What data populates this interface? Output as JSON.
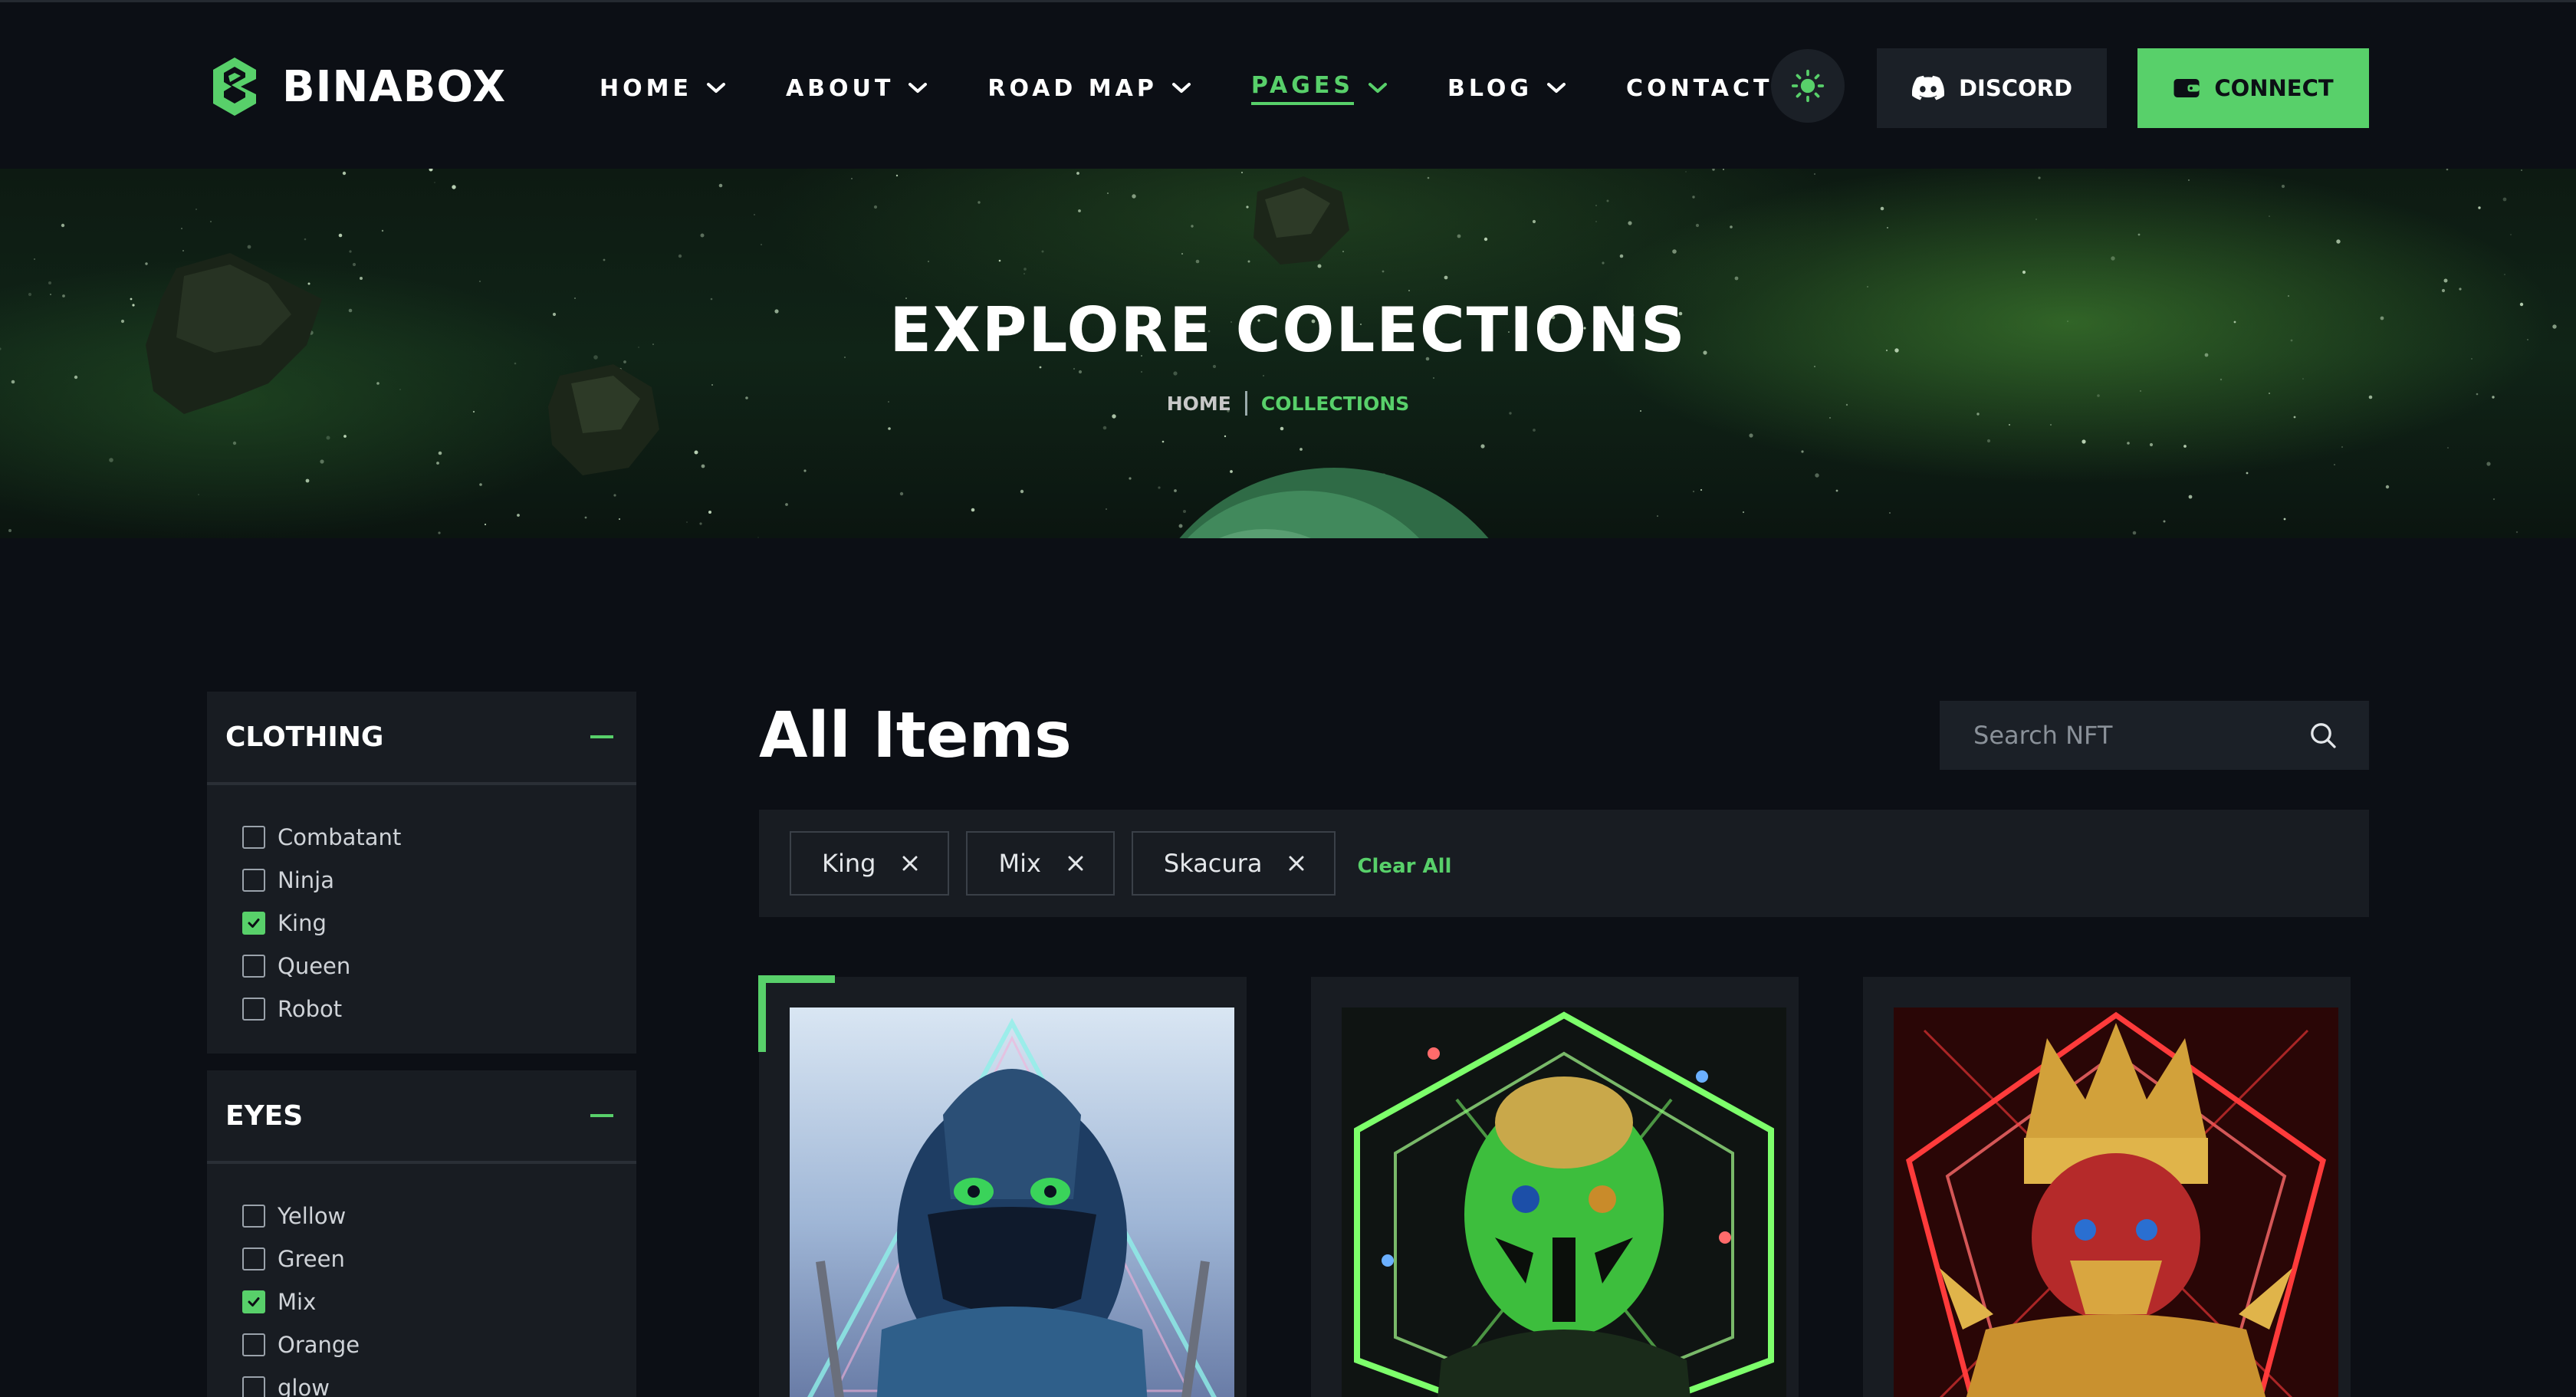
{
  "brand": {
    "name": "BINABOX",
    "accent": "#58d06a",
    "background": "#0c0f15",
    "panel": "#181c22"
  },
  "nav": {
    "items": [
      {
        "label": "HOME",
        "dropdown": true,
        "active": false
      },
      {
        "label": "ABOUT",
        "dropdown": true,
        "active": false
      },
      {
        "label": "ROAD MAP",
        "dropdown": true,
        "active": false
      },
      {
        "label": "PAGES",
        "dropdown": true,
        "active": true
      },
      {
        "label": "BLOG",
        "dropdown": true,
        "active": false
      },
      {
        "label": "CONTACT",
        "dropdown": false,
        "active": false
      }
    ],
    "theme_icon": "sun-icon",
    "discord_label": "DISCORD",
    "connect_label": "CONNECT"
  },
  "hero": {
    "title": "EXPLORE COLECTIONS",
    "breadcrumb_home": "HOME",
    "breadcrumb_current": "COLLECTIONS"
  },
  "filters": [
    {
      "title": "CLOTHING",
      "options": [
        {
          "label": "Combatant",
          "checked": false
        },
        {
          "label": "Ninja",
          "checked": false
        },
        {
          "label": "King",
          "checked": true
        },
        {
          "label": "Queen",
          "checked": false
        },
        {
          "label": "Robot",
          "checked": false
        }
      ]
    },
    {
      "title": "EYES",
      "options": [
        {
          "label": "Yellow",
          "checked": false
        },
        {
          "label": "Green",
          "checked": false
        },
        {
          "label": "Mix",
          "checked": true
        },
        {
          "label": "Orange",
          "checked": false
        },
        {
          "label": "glow",
          "checked": false
        }
      ]
    }
  ],
  "main": {
    "title": "All Items",
    "search_placeholder": "Search NFT",
    "chips": [
      "King",
      "Mix",
      "Skacura"
    ],
    "clear_all": "Clear All"
  },
  "cards": [
    {
      "theme": "blue-ninja"
    },
    {
      "theme": "green-alien"
    },
    {
      "theme": "red-gold-king"
    }
  ]
}
